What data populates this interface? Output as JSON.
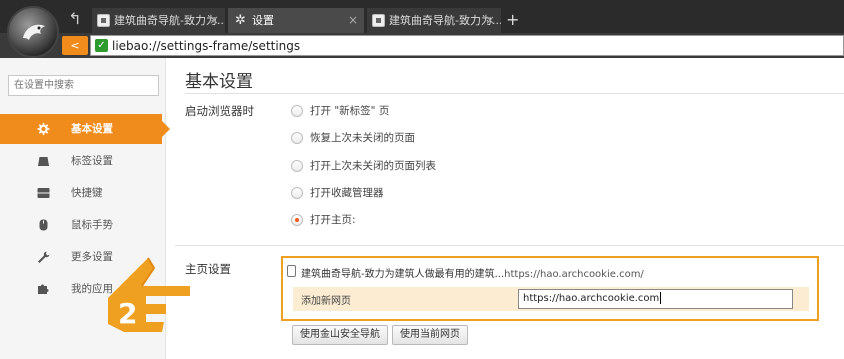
{
  "browser": {
    "tabs": [
      {
        "title": "建筑曲奇导航-致力为...",
        "active": false
      },
      {
        "title": "设置",
        "active": true
      },
      {
        "title": "建筑曲奇导航-致力为...",
        "active": false
      }
    ],
    "new_tab_label": "+",
    "close_label": "×",
    "url": "liebao://settings-frame/settings"
  },
  "sidebar": {
    "search_placeholder": "在设置中搜索",
    "items": [
      {
        "label": "基本设置",
        "icon": "gear-icon",
        "active": true
      },
      {
        "label": "标签设置",
        "icon": "tab-icon",
        "active": false
      },
      {
        "label": "快捷键",
        "icon": "keyboard-icon",
        "active": false
      },
      {
        "label": "鼠标手势",
        "icon": "mouse-icon",
        "active": false
      },
      {
        "label": "更多设置",
        "icon": "wrench-icon",
        "active": false
      },
      {
        "label": "我的应用",
        "icon": "puzzle-icon",
        "active": false
      }
    ]
  },
  "main": {
    "title": "基本设置",
    "startup": {
      "label": "启动浏览器时",
      "options": [
        {
          "label": "打开 \"新标签\" 页",
          "checked": false
        },
        {
          "label": "恢复上次未关闭的页面",
          "checked": false
        },
        {
          "label": "打开上次未关闭的页面列表",
          "checked": false
        },
        {
          "label": "打开收藏管理器",
          "checked": false
        },
        {
          "label": "打开主页:",
          "checked": true
        }
      ]
    },
    "homepage": {
      "label": "主页设置",
      "current_title": "建筑曲奇导航-致力为建筑人做最有用的建筑...",
      "current_url": "https://hao.archcookie.com/",
      "add_label": "添加新网页",
      "add_value": "https://hao.archcookie.com",
      "buttons": [
        "使用金山安全导航",
        "使用当前网页"
      ]
    }
  },
  "annotation": {
    "step_number": "2",
    "color": "#f0a020"
  }
}
